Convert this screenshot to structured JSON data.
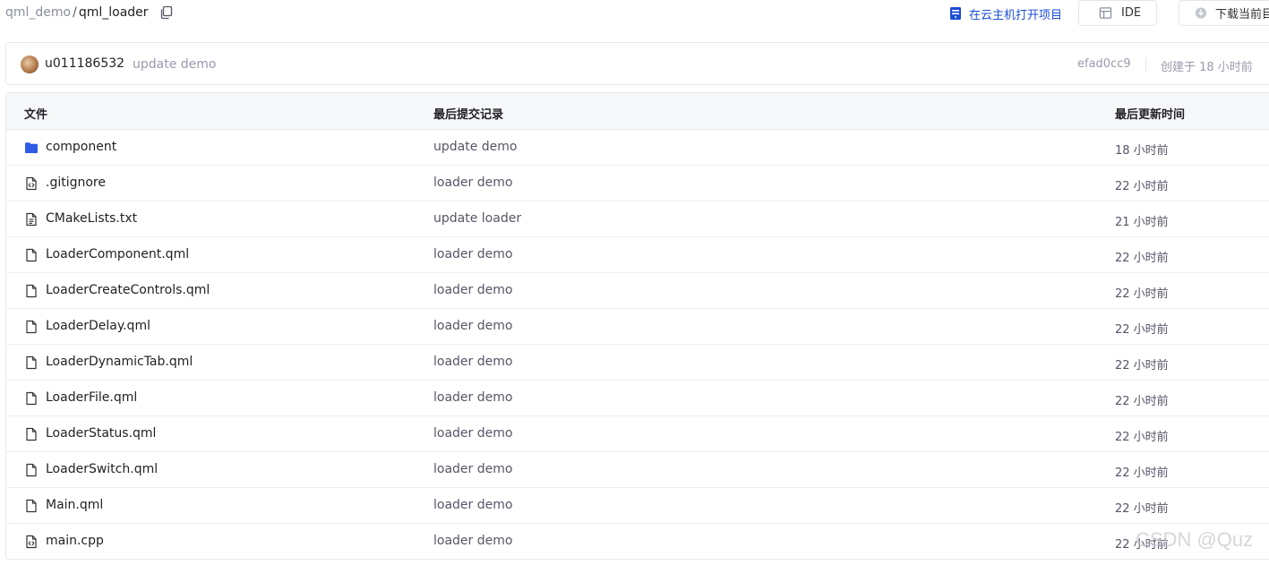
{
  "breadcrumb": {
    "parent": "qml_demo",
    "separator": "/",
    "current": "qml_loader"
  },
  "actions": {
    "cloud_open": "在云主机打开项目",
    "ide": "IDE",
    "download": "下载当前目录"
  },
  "commit": {
    "author": "u011186532",
    "message": "update demo",
    "hash": "efad0cc9",
    "time": "创建于 18 小时前"
  },
  "table": {
    "headers": {
      "file": "文件",
      "last_commit": "最后提交记录",
      "updated": "最后更新时间"
    },
    "rows": [
      {
        "name": "component",
        "icon": "folder-icon",
        "commit": "update demo",
        "time": "18 小时前"
      },
      {
        "name": ".gitignore",
        "icon": "code-file-icon",
        "commit": "loader demo",
        "time": "22 小时前"
      },
      {
        "name": "CMakeLists.txt",
        "icon": "text-file-icon",
        "commit": "update loader",
        "time": "21 小时前"
      },
      {
        "name": "LoaderComponent.qml",
        "icon": "file-icon",
        "commit": "loader demo",
        "time": "22 小时前"
      },
      {
        "name": "LoaderCreateControls.qml",
        "icon": "file-icon",
        "commit": "loader demo",
        "time": "22 小时前"
      },
      {
        "name": "LoaderDelay.qml",
        "icon": "file-icon",
        "commit": "loader demo",
        "time": "22 小时前"
      },
      {
        "name": "LoaderDynamicTab.qml",
        "icon": "file-icon",
        "commit": "loader demo",
        "time": "22 小时前"
      },
      {
        "name": "LoaderFile.qml",
        "icon": "file-icon",
        "commit": "loader demo",
        "time": "22 小时前"
      },
      {
        "name": "LoaderStatus.qml",
        "icon": "file-icon",
        "commit": "loader demo",
        "time": "22 小时前"
      },
      {
        "name": "LoaderSwitch.qml",
        "icon": "file-icon",
        "commit": "loader demo",
        "time": "22 小时前"
      },
      {
        "name": "Main.qml",
        "icon": "file-icon",
        "commit": "loader demo",
        "time": "22 小时前"
      },
      {
        "name": "main.cpp",
        "icon": "code-file-icon",
        "commit": "loader demo",
        "time": "22 小时前"
      }
    ]
  },
  "watermark": "CSDN @Quz",
  "colors": {
    "accent": "#1b4dd6",
    "folder": "#2d5be3",
    "muted_text": "#999aaa",
    "border": "#e6e8ee",
    "header_bg": "#f7f8fa"
  }
}
